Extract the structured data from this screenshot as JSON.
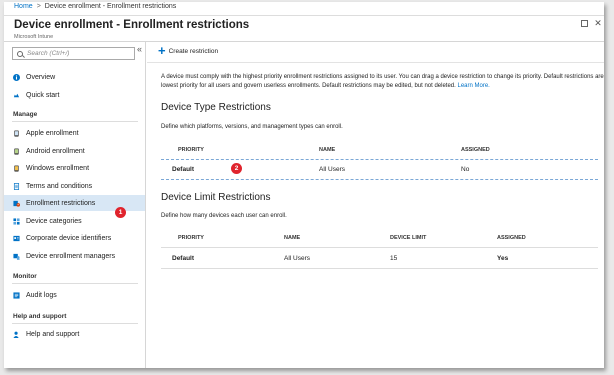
{
  "breadcrumb": {
    "home": "Home",
    "separator": ">",
    "current": "Device enrollment - Enrollment restrictions"
  },
  "blade": {
    "title": "Device enrollment - Enrollment restrictions",
    "subtitle": "Microsoft Intune",
    "maximize_icon": "square-icon",
    "close_icon": "close-icon"
  },
  "sidebar": {
    "search_placeholder": "Search (Ctrl+/)",
    "collapse_glyph": "«",
    "top_items": [
      {
        "label": "Overview",
        "icon": "info-icon",
        "color": "#0072c6"
      },
      {
        "label": "Quick start",
        "icon": "cloud-icon",
        "color": "#0072c6"
      }
    ],
    "manage_header": "Manage",
    "manage_items": [
      {
        "label": "Apple enrollment",
        "icon": "apple-device-icon",
        "color": "#555555"
      },
      {
        "label": "Android enrollment",
        "icon": "android-device-icon",
        "color": "#555555"
      },
      {
        "label": "Windows enrollment",
        "icon": "windows-device-icon",
        "color": "#555555"
      },
      {
        "label": "Terms and conditions",
        "icon": "document-icon",
        "color": "#0072c6"
      },
      {
        "label": "Enrollment restrictions",
        "icon": "restriction-icon",
        "color": "#0072c6"
      },
      {
        "label": "Device categories",
        "icon": "category-icon",
        "color": "#0072c6"
      },
      {
        "label": "Corporate device identifiers",
        "icon": "identifier-icon",
        "color": "#0072c6"
      },
      {
        "label": "Device enrollment managers",
        "icon": "user-device-icon",
        "color": "#0072c6"
      }
    ],
    "monitor_header": "Monitor",
    "monitor_items": [
      {
        "label": "Audit logs",
        "icon": "log-icon",
        "color": "#0072c6"
      }
    ],
    "help_header": "Help and support",
    "help_items": [
      {
        "label": "Help and support",
        "icon": "help-icon",
        "color": "#0072c6"
      }
    ]
  },
  "callouts": {
    "one": "1",
    "two": "2"
  },
  "toolbar": {
    "create_label": "Create restriction"
  },
  "description": {
    "text": "A device must comply with the highest priority enrollment restrictions assigned to its user. You can drag a device restriction to change its priority. Default restrictions are lowest priority for all users and govern userless enrollments. Default restrictions may be edited, but not deleted.",
    "link": "Learn More."
  },
  "type_restrictions": {
    "heading": "Device Type Restrictions",
    "subtitle": "Define which platforms, versions, and management types can enroll.",
    "columns": [
      "PRIORITY",
      "NAME",
      "ASSIGNED"
    ],
    "rows": [
      {
        "priority": "Default",
        "name": "All Users",
        "assigned": "No"
      }
    ]
  },
  "limit_restrictions": {
    "heading": "Device Limit Restrictions",
    "subtitle": "Define how many devices each user can enroll.",
    "columns": [
      "PRIORITY",
      "NAME",
      "DEVICE LIMIT",
      "ASSIGNED"
    ],
    "rows": [
      {
        "priority": "Default",
        "name": "All Users",
        "limit": "15",
        "assigned": "Yes"
      }
    ]
  }
}
